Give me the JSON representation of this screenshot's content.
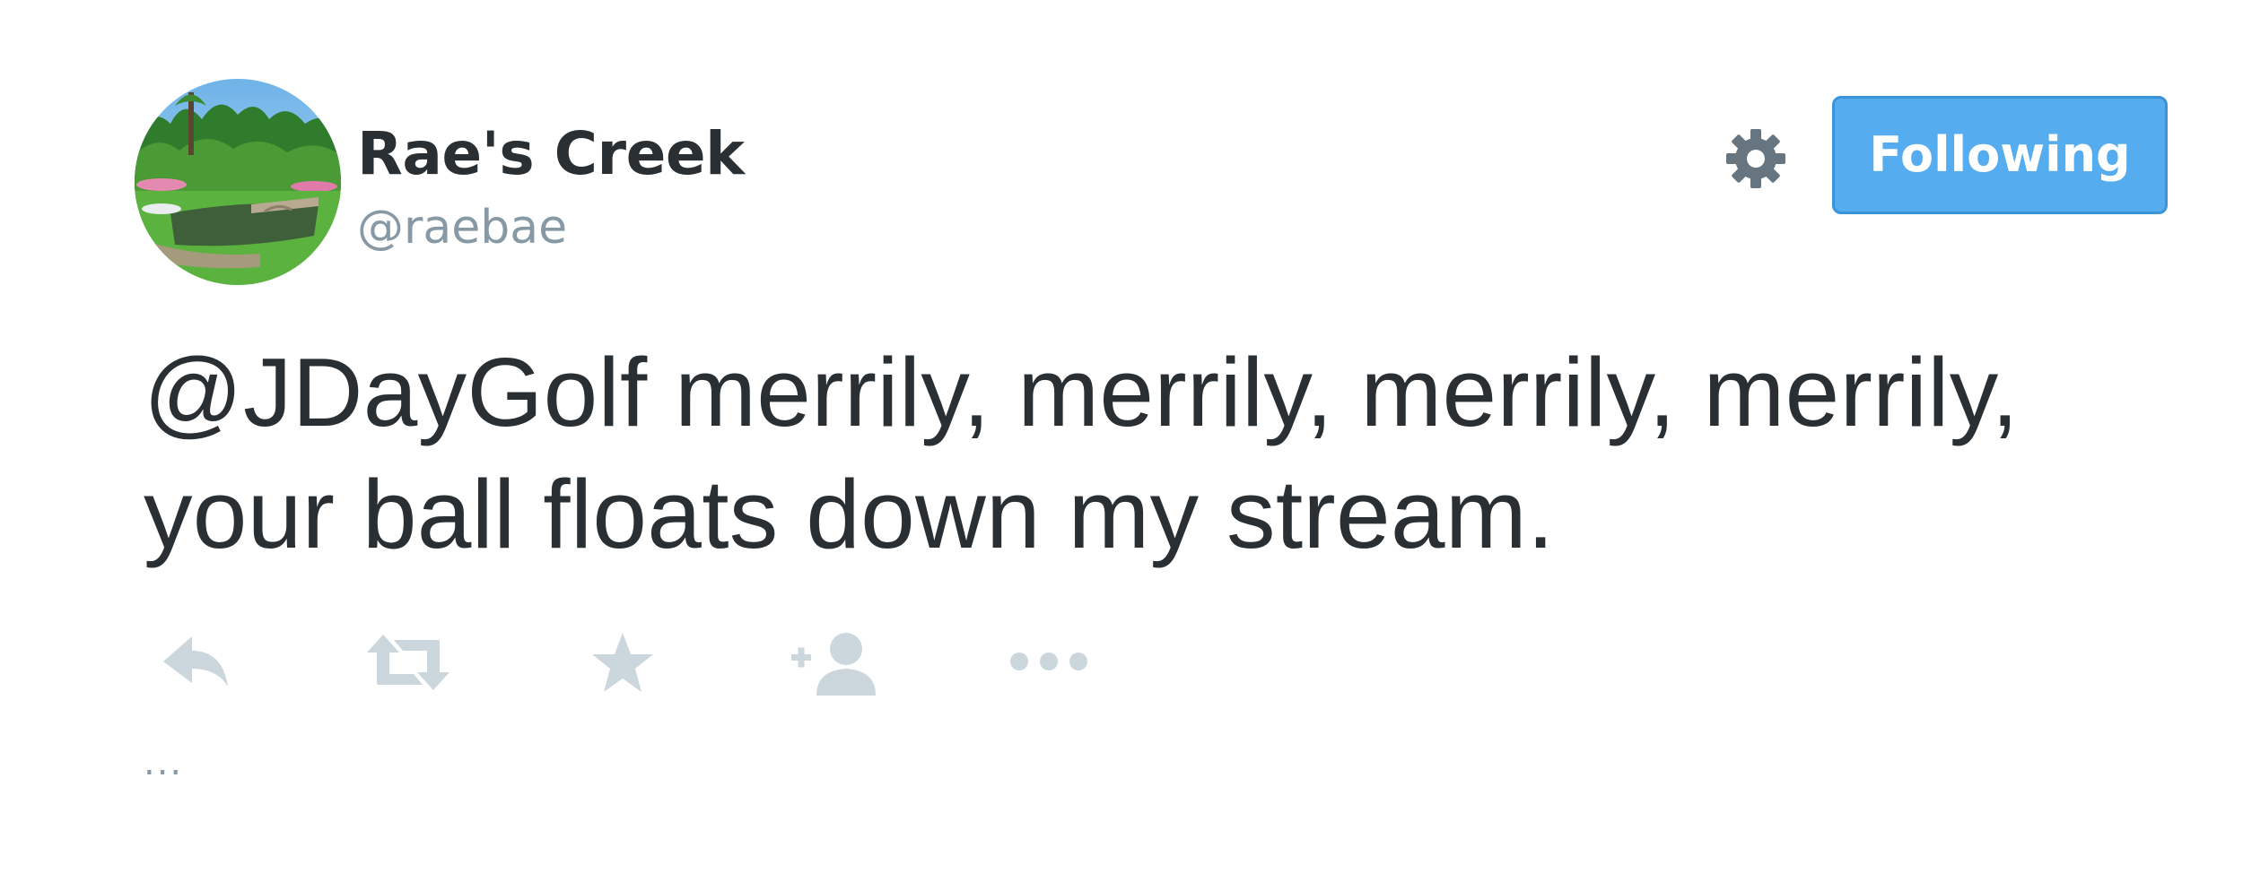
{
  "user": {
    "display_name": "Rae's Creek",
    "handle": "@raebae",
    "avatar_icon": "golf-course-bridge-photo"
  },
  "header": {
    "settings_icon": "gear-icon",
    "follow_button_label": "Following"
  },
  "tweet": {
    "text": "@JDayGolf merrily, merrily, merrily, merrily, your ball floats down my stream.",
    "truncation": "..."
  },
  "actions": [
    {
      "name": "reply",
      "icon": "reply-icon"
    },
    {
      "name": "retweet",
      "icon": "retweet-icon"
    },
    {
      "name": "favorite",
      "icon": "star-icon"
    },
    {
      "name": "follow",
      "icon": "add-user-icon"
    },
    {
      "name": "more",
      "icon": "more-dots-icon"
    }
  ],
  "colors": {
    "text": "#292f33",
    "secondary": "#8899a6",
    "action_icon": "#ccd6dd",
    "button_bg": "#55acee",
    "button_border": "#3b94d9",
    "gear": "#66757f"
  }
}
